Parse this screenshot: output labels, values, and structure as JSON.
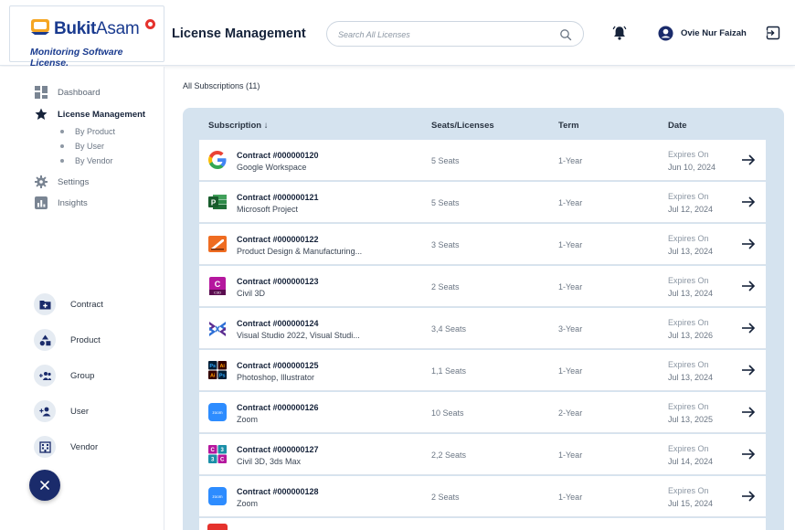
{
  "brand": {
    "name_bold": "Bukit",
    "name_thin": "Asam",
    "tagline": "Monitoring Software License."
  },
  "header": {
    "title": "License Management",
    "search_placeholder": "Search All Licenses",
    "user_name": "Ovie Nur Faizah"
  },
  "sidebar": {
    "items": [
      {
        "label": "Dashboard",
        "icon": "dashboard-icon"
      },
      {
        "label": "License Management",
        "icon": "star-icon",
        "active": true
      },
      {
        "label": "Settings",
        "icon": "gear-icon"
      },
      {
        "label": "Insights",
        "icon": "chart-icon"
      }
    ],
    "sub_items": [
      {
        "label": "By Product"
      },
      {
        "label": "By User"
      },
      {
        "label": "By Vendor"
      }
    ],
    "quick_actions": [
      {
        "label": "Contract",
        "icon": "folder-add-icon"
      },
      {
        "label": "Product",
        "icon": "shapes-icon"
      },
      {
        "label": "Group",
        "icon": "group-add-icon"
      },
      {
        "label": "User",
        "icon": "user-add-icon"
      },
      {
        "label": "Vendor",
        "icon": "building-icon"
      }
    ],
    "close_icon": "close-icon"
  },
  "main": {
    "heading": "All Subscriptions (11)",
    "columns": {
      "subscription": "Subscription ↓",
      "seats": "Seats/Licenses",
      "term": "Term",
      "date": "Date"
    },
    "rows": [
      {
        "contract": "Contract #000000120",
        "product": "Google Workspace",
        "seats": "5 Seats",
        "term": "1-Year",
        "expires_label": "Expires On",
        "expires_date": "Jun 10, 2024",
        "logo": "google-logo-icon"
      },
      {
        "contract": "Contract #000000121",
        "product": "Microsoft Project",
        "seats": "5 Seats",
        "term": "1-Year",
        "expires_label": "Expires On",
        "expires_date": "Jul 12, 2024",
        "logo": "ms-project-logo-icon"
      },
      {
        "contract": "Contract #000000122",
        "product": "Product Design & Manufacturing...",
        "seats": "3 Seats",
        "term": "1-Year",
        "expires_label": "Expires On",
        "expires_date": "Jul 13, 2024",
        "logo": "autodesk-pdm-logo-icon"
      },
      {
        "contract": "Contract #000000123",
        "product": "Civil 3D",
        "seats": "2 Seats",
        "term": "1-Year",
        "expires_label": "Expires On",
        "expires_date": "Jul 13, 2024",
        "logo": "civil3d-logo-icon"
      },
      {
        "contract": "Contract #000000124",
        "product": "Visual Studio 2022, Visual Studi...",
        "seats": "3,4 Seats",
        "term": "3-Year",
        "expires_label": "Expires On",
        "expires_date": "Jul 13, 2026",
        "logo": "visual-studio-logo-icon"
      },
      {
        "contract": "Contract #000000125",
        "product": "Photoshop, Illustrator",
        "seats": "1,1 Seats",
        "term": "1-Year",
        "expires_label": "Expires On",
        "expires_date": "Jul 13, 2024",
        "logo": "adobe-logo-icon"
      },
      {
        "contract": "Contract #000000126",
        "product": "Zoom",
        "seats": "10 Seats",
        "term": "2-Year",
        "expires_label": "Expires On",
        "expires_date": "Jul 13, 2025",
        "logo": "zoom-logo-icon"
      },
      {
        "contract": "Contract #000000127",
        "product": "Civil 3D, 3ds Max",
        "seats": "2,2 Seats",
        "term": "1-Year",
        "expires_label": "Expires On",
        "expires_date": "Jul 14, 2024",
        "logo": "civil3d-3dsmax-logo-icon"
      },
      {
        "contract": "Contract #000000128",
        "product": "Zoom",
        "seats": "2 Seats",
        "term": "1-Year",
        "expires_label": "Expires On",
        "expires_date": "Jul 15, 2024",
        "logo": "zoom-logo-icon"
      }
    ]
  },
  "colors": {
    "brand_navy": "#1a3b8f",
    "brand_red": "#e5322d",
    "panel_bg": "#d5e3ef",
    "fab_bg": "#1a2b6b"
  }
}
